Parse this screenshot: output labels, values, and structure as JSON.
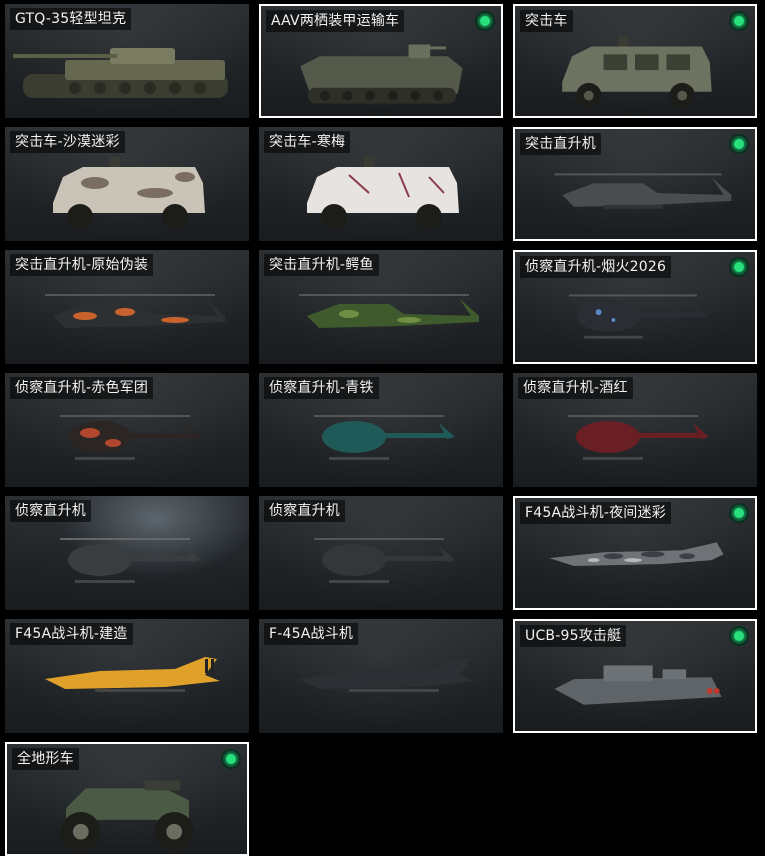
{
  "vehicles": [
    {
      "name": "GTQ-35轻型坦克",
      "owned": false,
      "icon": "light-tank-icon"
    },
    {
      "name": "AAV两栖装甲运输车",
      "owned": true,
      "icon": "amphibious-apc-icon"
    },
    {
      "name": "突击车",
      "owned": true,
      "icon": "assault-vehicle-icon"
    },
    {
      "name": "突击车-沙漠迷彩",
      "owned": false,
      "icon": "assault-vehicle-desert-icon"
    },
    {
      "name": "突击车-寒梅",
      "owned": false,
      "icon": "assault-vehicle-plum-icon"
    },
    {
      "name": "突击直升机",
      "owned": true,
      "icon": "attack-helicopter-icon"
    },
    {
      "name": "突击直升机-原始伪装",
      "owned": false,
      "icon": "attack-helicopter-camo-icon"
    },
    {
      "name": "突击直升机-鳄鱼",
      "owned": false,
      "icon": "attack-helicopter-croc-icon"
    },
    {
      "name": "侦察直升机-烟火2026",
      "owned": true,
      "icon": "scout-helicopter-fireworks-icon"
    },
    {
      "name": "侦察直升机-赤色军团",
      "owned": false,
      "icon": "scout-helicopter-red-legion-icon"
    },
    {
      "name": "侦察直升机-青铁",
      "owned": false,
      "icon": "scout-helicopter-teal-icon"
    },
    {
      "name": "侦察直升机-酒红",
      "owned": false,
      "icon": "scout-helicopter-wine-icon"
    },
    {
      "name": "侦察直升机",
      "owned": false,
      "icon": "scout-helicopter-icon"
    },
    {
      "name": "侦察直升机",
      "owned": false,
      "icon": "scout-helicopter-icon"
    },
    {
      "name": "F45A战斗机-夜间迷彩",
      "owned": true,
      "icon": "fighter-jet-night-camo-icon"
    },
    {
      "name": "F45A战斗机-建造",
      "owned": false,
      "icon": "fighter-jet-construction-icon"
    },
    {
      "name": "F-45A战斗机",
      "owned": false,
      "icon": "fighter-jet-icon"
    },
    {
      "name": "UCB-95攻击艇",
      "owned": true,
      "icon": "attack-boat-icon"
    },
    {
      "name": "全地形车",
      "owned": true,
      "icon": "atv-icon"
    }
  ],
  "colors": {
    "owned_indicator": "#27e07c",
    "selected_border": "#ffffff",
    "background": "#000000"
  }
}
